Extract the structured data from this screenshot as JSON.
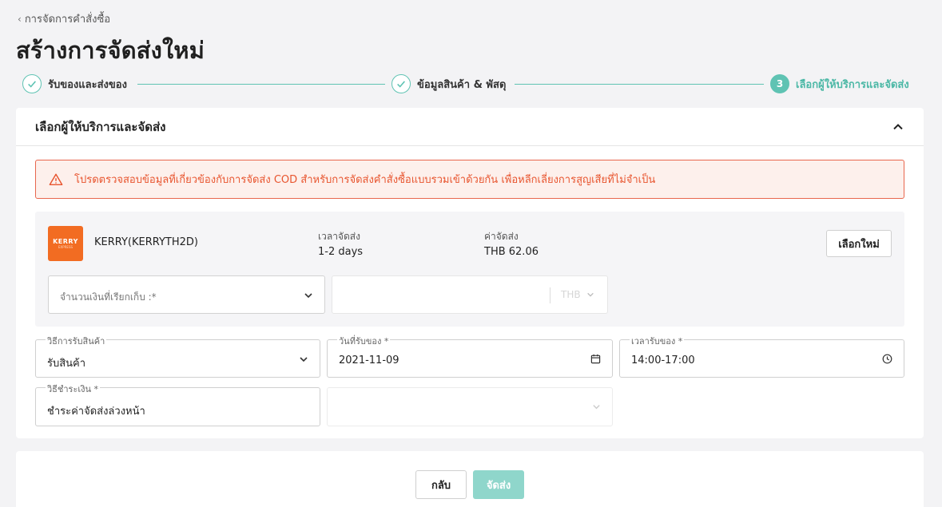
{
  "breadcrumb": {
    "label": "การจัดการคำสั่งซื้อ"
  },
  "page_title": "สร้างการจัดส่งใหม่",
  "steps": [
    {
      "label": "รับของและส่งของ",
      "status": "done"
    },
    {
      "label": "ข้อมูลสินค้า & พัสดุ",
      "status": "done"
    },
    {
      "number": "3",
      "label": "เลือกผู้ให้บริการและจัดส่ง",
      "status": "active"
    }
  ],
  "section": {
    "title": "เลือกผู้ให้บริการและจัดส่ง"
  },
  "alert": {
    "text": "โปรดตรวจสอบข้อมูลที่เกี่ยวข้องกับการจัดส่ง COD สำหรับการจัดส่งคำสั่งซื้อแบบรวมเข้าด้วยกัน เพื่อหลีกเลี่ยงการสูญเสียที่ไม่จำเป็น"
  },
  "courier": {
    "logo_text": "KERRY",
    "logo_sub": "EXPRESS",
    "name": "KERRY(KERRYTH2D)",
    "delivery_time_label": "เวลาจัดส่ง",
    "delivery_time_value": "1-2 days",
    "fee_label": "ค่าจัดส่ง",
    "fee_value": "THB 62.06",
    "reselect_label": "เลือกใหม่"
  },
  "cod": {
    "amount_placeholder": "จำนวนเงินที่เรียกเก็บ :*",
    "currency": "THB"
  },
  "pickup": {
    "method_label": "วิธีการรับสินค้า",
    "method_value": "รับสินค้า",
    "date_label": "วันที่รับของ *",
    "date_value": "2021-11-09",
    "time_label": "เวลารับของ *",
    "time_value": "14:00-17:00"
  },
  "payment": {
    "label": "วิธีชำระเงิน *",
    "value": "ชำระค่าจัดส่งล่วงหน้า"
  },
  "footer": {
    "back_label": "กลับ",
    "submit_label": "จัดส่ง"
  },
  "colors": {
    "accent": "#5fc3b3",
    "alert": "#e8552f",
    "kerry": "#f26c22"
  }
}
